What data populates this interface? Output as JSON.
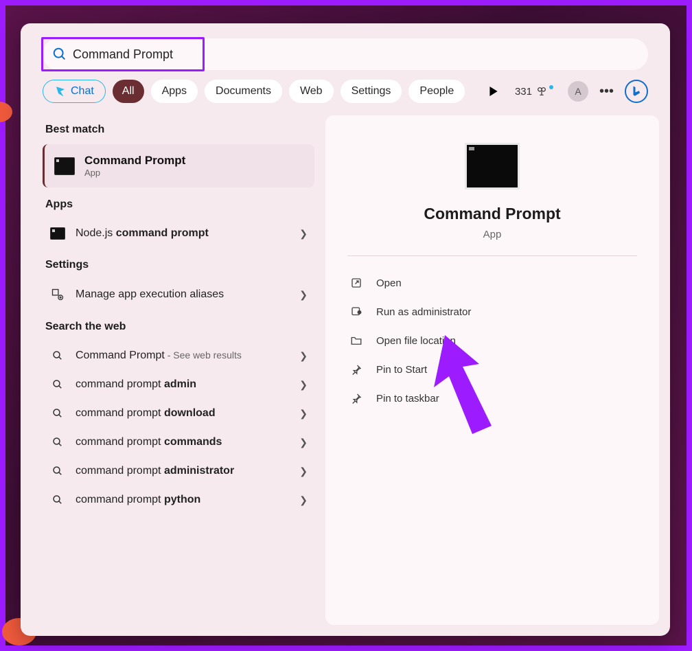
{
  "search": {
    "value": "Command Prompt"
  },
  "toolbar": {
    "chat": "Chat",
    "all": "All",
    "tabs": [
      "Apps",
      "Documents",
      "Web",
      "Settings",
      "People"
    ],
    "xpCount": "331",
    "avatarLetter": "A"
  },
  "left": {
    "bestMatch": {
      "header": "Best match",
      "title": "Command Prompt",
      "subtitle": "App"
    },
    "appsHeader": "Apps",
    "apps": [
      {
        "pre": "Node.js ",
        "bold": "command prompt"
      }
    ],
    "settingsHeader": "Settings",
    "settings": [
      {
        "text": "Manage app execution aliases"
      }
    ],
    "webHeader": "Search the web",
    "web": [
      {
        "pre": "Command Prompt",
        "suffix": " - See web results"
      },
      {
        "pre": "command prompt ",
        "bold": "admin"
      },
      {
        "pre": "command prompt ",
        "bold": "download"
      },
      {
        "pre": "command prompt ",
        "bold": "commands"
      },
      {
        "pre": "command prompt ",
        "bold": "administrator"
      },
      {
        "pre": "command prompt ",
        "bold": "python"
      }
    ]
  },
  "right": {
    "title": "Command Prompt",
    "subtitle": "App",
    "actions": [
      {
        "icon": "open",
        "label": "Open"
      },
      {
        "icon": "admin",
        "label": "Run as administrator"
      },
      {
        "icon": "folder",
        "label": "Open file location"
      },
      {
        "icon": "pin",
        "label": "Pin to Start"
      },
      {
        "icon": "pin",
        "label": "Pin to taskbar"
      }
    ]
  }
}
